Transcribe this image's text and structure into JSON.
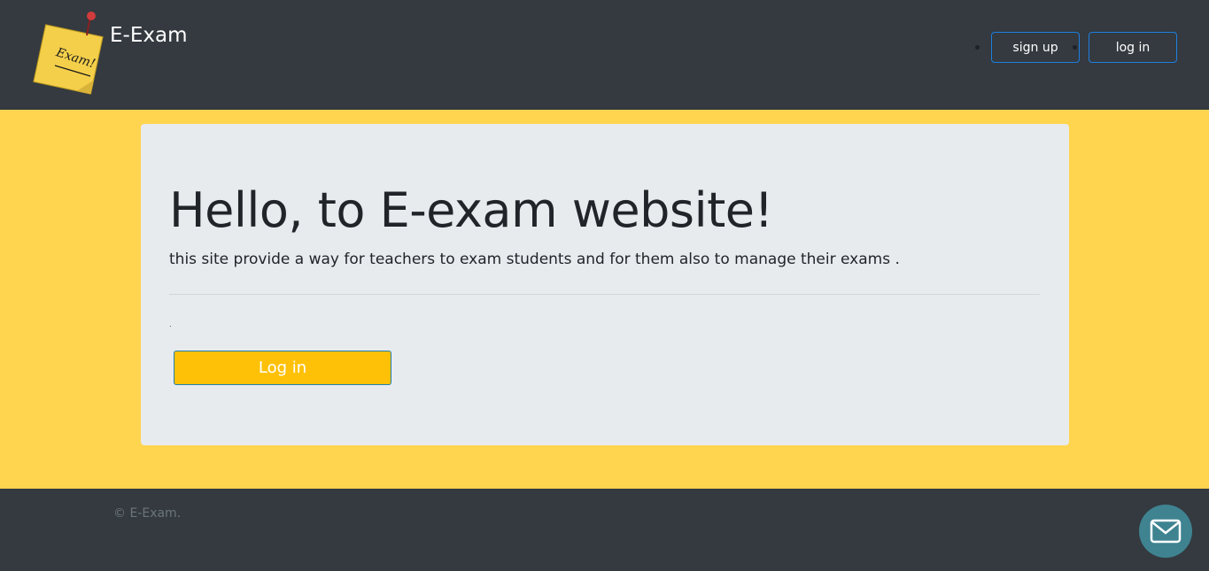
{
  "header": {
    "brand": "E-Exam",
    "logo_text": "Exam!",
    "nav": [
      {
        "label": "sign up"
      },
      {
        "label": "log in"
      }
    ]
  },
  "hero": {
    "title": "Hello, to E-exam website!",
    "lead": "this site provide a way for teachers to exam students and for them also to manage their exams .",
    "small_text": ".",
    "login_button": "Log in"
  },
  "footer": {
    "copyright": "© E-Exam."
  },
  "colors": {
    "header_bg": "#343a40",
    "main_bg": "#ffd54f",
    "card_bg": "#e8ebee",
    "button_accent": "#ffc107",
    "chat_button": "#3f8391"
  },
  "icons": {
    "logo": "exam-note-icon",
    "chat": "mail-icon"
  }
}
